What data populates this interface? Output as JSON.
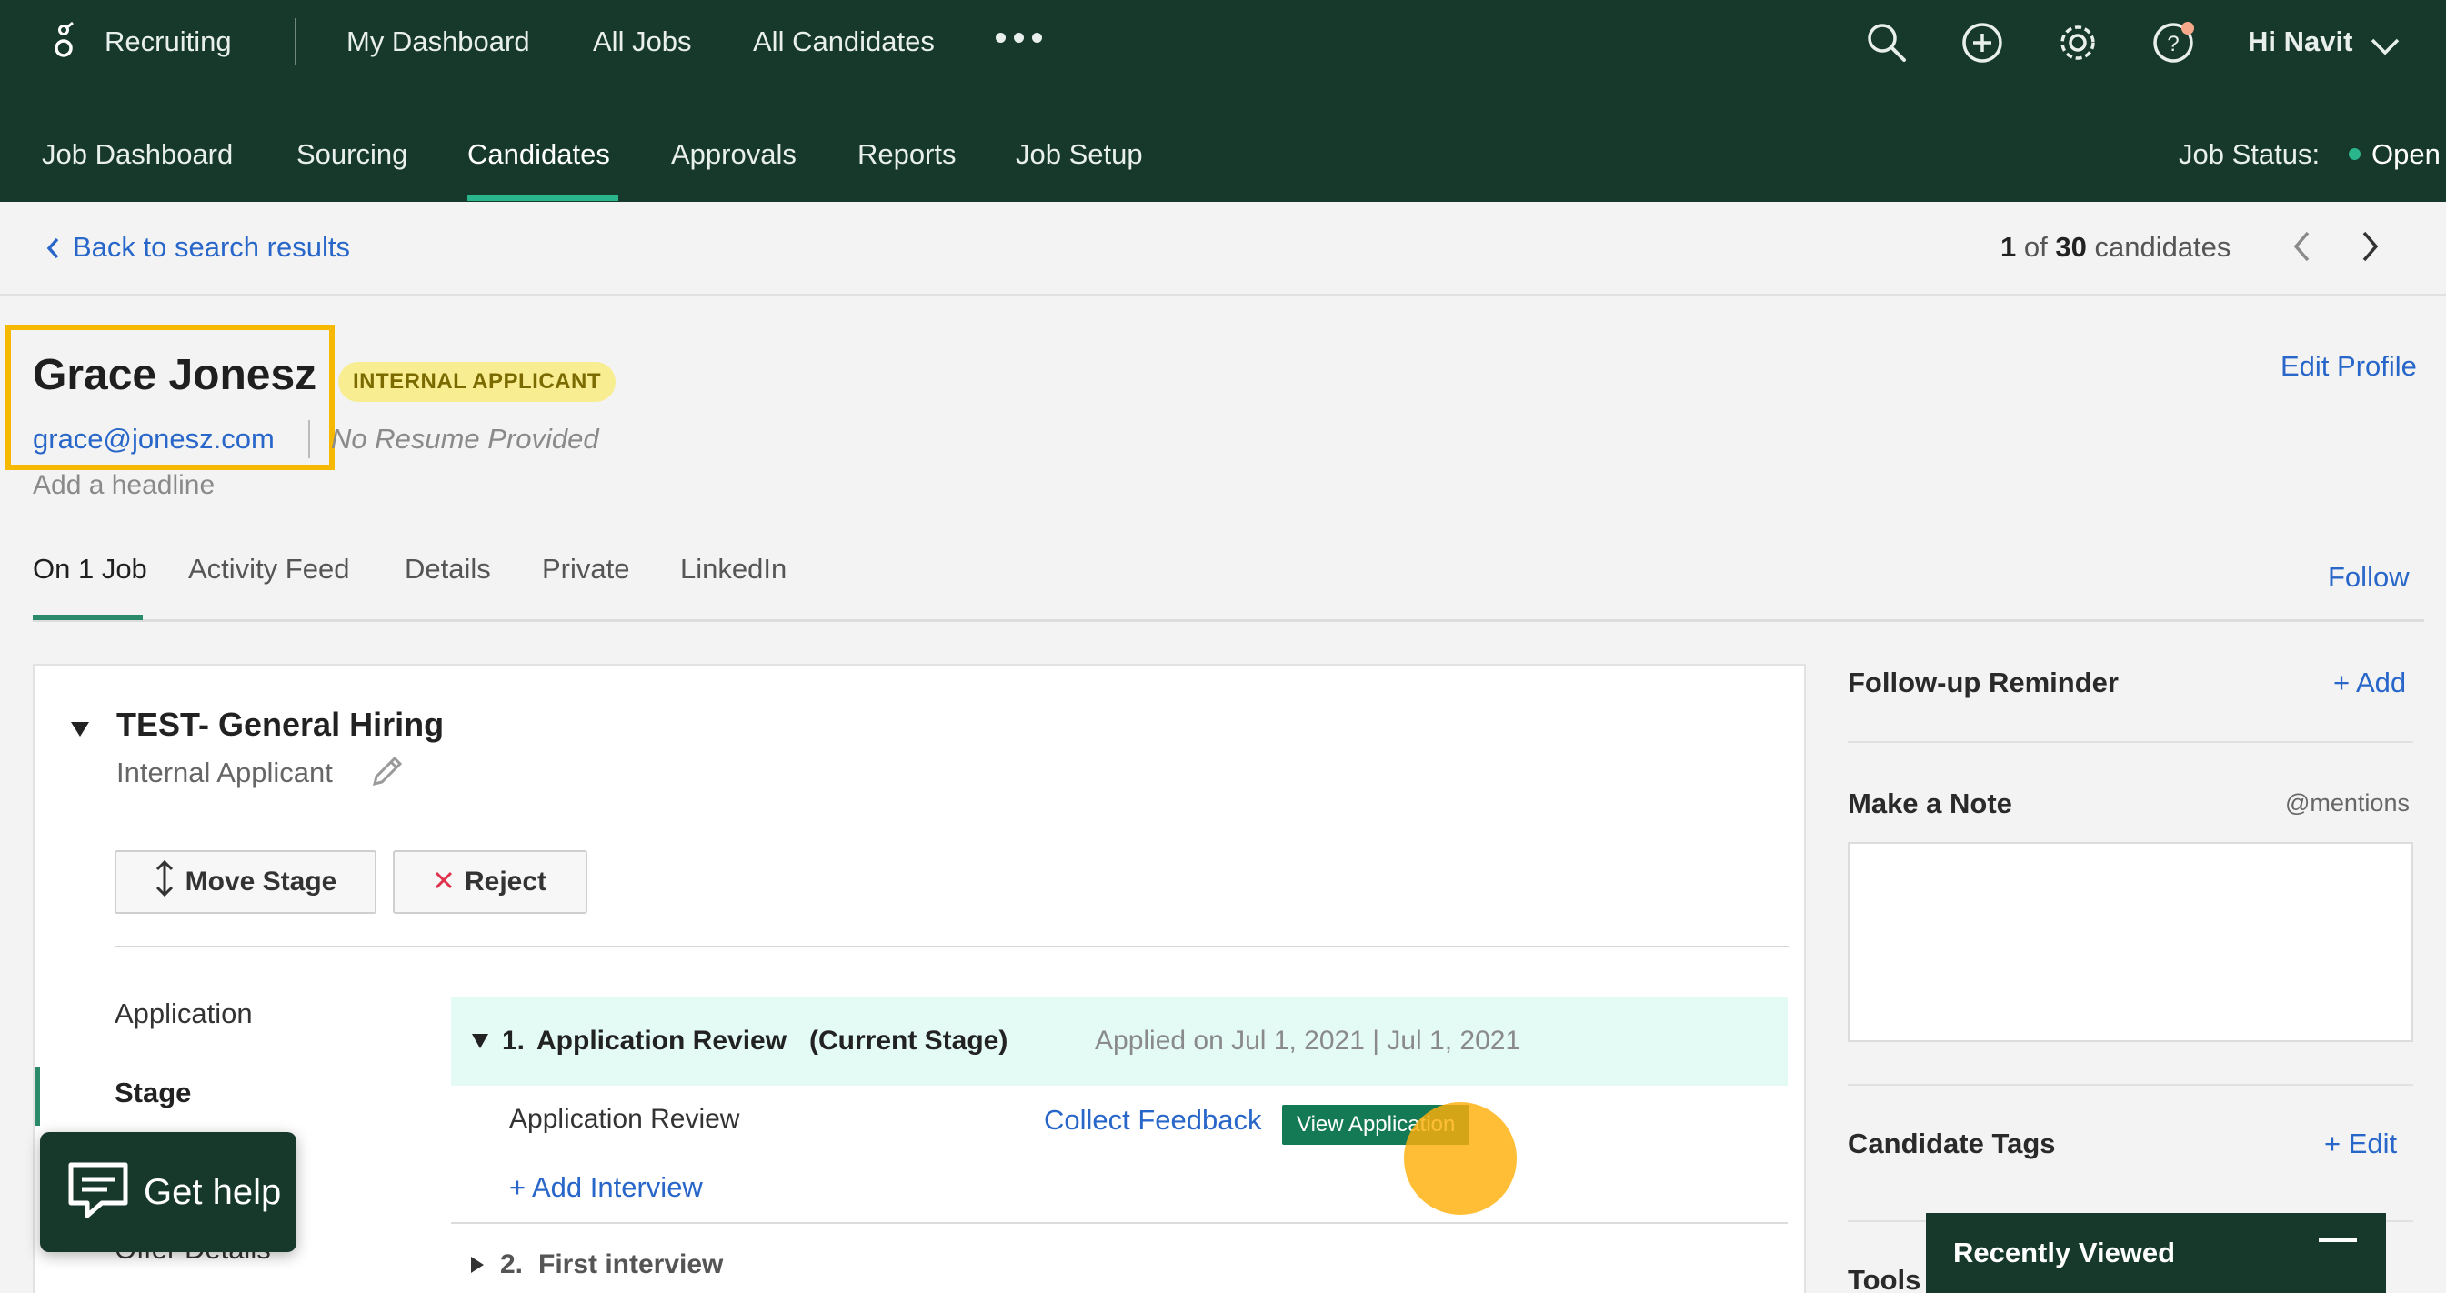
{
  "topbar": {
    "brand": "Recruiting",
    "nav": [
      "My Dashboard",
      "All Jobs",
      "All Candidates"
    ],
    "more": "•••",
    "greeting": "Hi Navit",
    "icons": [
      "search-icon",
      "plus-circle-icon",
      "gear-icon",
      "help-icon",
      "chevron-down-icon"
    ]
  },
  "subnav": {
    "items": [
      "Job Dashboard",
      "Sourcing",
      "Candidates",
      "Approvals",
      "Reports",
      "Job Setup"
    ],
    "active": "Candidates",
    "job_status_label": "Job Status:",
    "job_status_value": "Open"
  },
  "breadcrumb": {
    "back": "Back to search results",
    "current": "1",
    "of": "of",
    "total": "30",
    "suffix": "candidates"
  },
  "candidate": {
    "name": "Grace Jonesz",
    "badge": "INTERNAL APPLICANT",
    "email": "grace@jonesz.com",
    "resume": "No Resume Provided",
    "headline_placeholder": "Add a headline",
    "edit_profile": "Edit Profile"
  },
  "tabs": {
    "items": [
      "On 1 Job",
      "Activity Feed",
      "Details",
      "Private",
      "LinkedIn"
    ],
    "active": "On 1 Job",
    "follow": "Follow"
  },
  "job": {
    "title": "TEST- General Hiring",
    "subtitle": "Internal Applicant",
    "move_stage": "Move Stage",
    "reject": "Reject",
    "side_nav": [
      "Application",
      "Stage",
      "Offer Details"
    ],
    "stage_number": "1.",
    "stage_name": "Application Review",
    "current_stage": "(Current Stage)",
    "applied": "Applied on Jul 1, 2021 | Jul 1, 2021",
    "row_label": "Application Review",
    "collect_feedback": "Collect Feedback",
    "view_application": "View Application",
    "add_interview": "+ Add Interview",
    "next_stage_number": "2.",
    "next_stage_name": "First interview"
  },
  "right": {
    "followup_title": "Follow-up Reminder",
    "followup_add": "+ Add",
    "note_title": "Make a Note",
    "note_mentions": "@mentions",
    "tags_title": "Candidate Tags",
    "tags_edit": "+ Edit",
    "tools_title": "Tools"
  },
  "overlays": {
    "help": "Get help",
    "recently_viewed": "Recently Viewed"
  },
  "colors": {
    "header_bg": "#16392c",
    "accent": "#2ab58d",
    "link": "#2867c9",
    "badge_bg": "#f8ee91",
    "stage_bg": "#e3fbf4",
    "view_btn": "#137a55",
    "highlight": "#f6b800"
  }
}
